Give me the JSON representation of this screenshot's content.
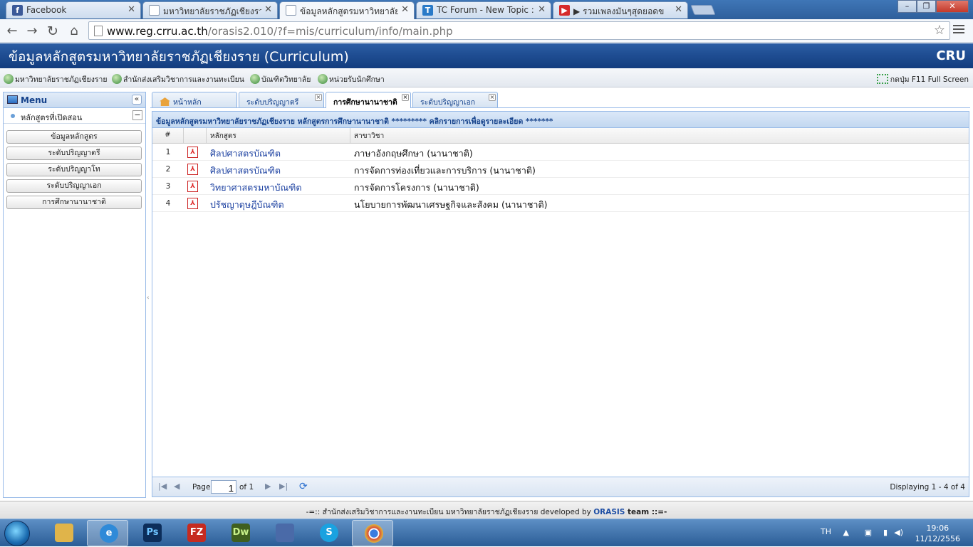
{
  "browser": {
    "tabs": [
      {
        "title": "Facebook",
        "icon": "facebook-icon",
        "color": "#3b5998"
      },
      {
        "title": "มหาวิทยาลัยราชภัฏเชียงราย :",
        "icon": "page-icon",
        "color": "#8a9ab0"
      },
      {
        "title": "ข้อมูลหลักสูตรมหาวิทยาลัยราช",
        "icon": "page-icon",
        "color": "#8a9ab0"
      },
      {
        "title": "TC Forum - New Topic :: ",
        "icon": "tc-forum-icon",
        "color": "#2a7ac8"
      },
      {
        "title": "▶ รวมเพลงมันๆสุดยอดข",
        "icon": "youtube-icon",
        "color": "#d62a2a"
      }
    ],
    "url_host": "www.reg.crru.ac.th",
    "url_path": "/orasis2.010/?f=mis/curriculum/info/main.php"
  },
  "app": {
    "title": "ข้อมูลหลักสูตรมหาวิทยาลัยราชภัฏเชียงราย (Curriculum)",
    "brand": "CRU",
    "links": [
      "มหาวิทยาลัยราชภัฏเชียงราย",
      "สำนักส่งเสริมวิชาการและงานทะเบียน",
      "บัณฑิตวิทยาลัย",
      "หน่วยรับนักศึกษา"
    ],
    "fullscreen": "กดปุ่ม F11 Full Screen"
  },
  "sidebar": {
    "title": "Menu",
    "section": "หลักสูตรที่เปิดสอน",
    "buttons": [
      "ข้อมูลหลักสูตร",
      "ระดับปริญญาตรี",
      "ระดับปริญญาโท",
      "ระดับปริญญาเอก",
      "การศึกษานานาชาติ"
    ]
  },
  "center": {
    "tabs": [
      {
        "label": "หน้าหลัก"
      },
      {
        "label": "ระดับปริญญาตรี"
      },
      {
        "label": "การศึกษานานาชาติ"
      },
      {
        "label": "ระดับปริญญาเอก"
      }
    ],
    "grid_title": "ข้อมูลหลักสูตรมหาวิทยาลัยราชภัฏเชียงราย หลักสูตรการศึกษานานาชาติ ********* คลิกรายการเพื่อดูรายละเอียด *******",
    "columns": [
      "#",
      "หลักสูตร",
      "สาขาวิชา"
    ],
    "rows": [
      {
        "n": "1",
        "program": "ศิลปศาสตรบัณฑิต",
        "major": "ภาษาอังกฤษศึกษา (นานาชาติ)"
      },
      {
        "n": "2",
        "program": "ศิลปศาสตรบัณฑิต",
        "major": "การจัดการท่องเที่ยวและการบริการ (นานาชาติ)"
      },
      {
        "n": "3",
        "program": "วิทยาศาสตรมหาบัณฑิต",
        "major": "การจัดการโครงการ (นานาชาติ)"
      },
      {
        "n": "4",
        "program": "ปรัชญาดุษฎีบัณฑิต",
        "major": "นโยบายการพัฒนาเศรษฐกิจและสังคม (นานาชาติ)"
      }
    ],
    "pager": {
      "page_label": "Page",
      "page": "1",
      "of": "of 1",
      "display": "Displaying 1 - 4 of 4"
    }
  },
  "footer": {
    "left": "-=:: สำนักส่งเสริมวิชาการและงานทะเบียน มหาวิทยาลัยราชภัฏเชียงราย developed by ",
    "brand": "ORASIS",
    "right": " team ::=-"
  },
  "taskbar": {
    "apps": [
      {
        "name": "explorer-icon",
        "label": "",
        "color": "#e0b44a"
      },
      {
        "name": "internet-explorer-icon",
        "label": "e",
        "color": "#2f8ad8"
      },
      {
        "name": "photoshop-icon",
        "label": "Ps",
        "color": "#0c2d5a"
      },
      {
        "name": "filezilla-icon",
        "label": "FZ",
        "color": "#c62b20"
      },
      {
        "name": "dreamweaver-icon",
        "label": "Dw",
        "color": "#3f5f1e"
      },
      {
        "name": "network-icon",
        "label": "",
        "color": "#4a6aa8"
      },
      {
        "name": "skype-icon",
        "label": "S",
        "color": "#1aa2e0"
      },
      {
        "name": "chrome-icon",
        "label": "",
        "color": "#d64a3a"
      }
    ],
    "lang": "TH",
    "time": "19:06",
    "date": "11/12/2556"
  }
}
